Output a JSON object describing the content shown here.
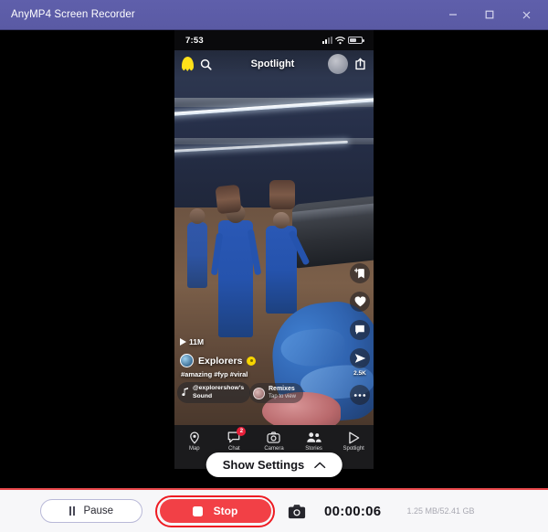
{
  "window": {
    "title": "AnyMP4 Screen Recorder",
    "controls": {
      "minimize": "minimize-icon",
      "maximize": "maximize-icon",
      "close": "close-icon"
    },
    "titlebar_color": "#5c5ca8"
  },
  "phone": {
    "status_bar": {
      "time": "7:53",
      "signal_icon": "cellular-signal-icon",
      "wifi_icon": "wifi-icon",
      "battery_icon": "battery-icon"
    },
    "header": {
      "profile_icon": "bitmoji-ghost-icon",
      "search_icon": "search-icon",
      "title": "Spotlight",
      "avatar": "avatar",
      "share_icon": "share-export-icon"
    },
    "video": {
      "view_count": "11M",
      "play_icon": "play-icon",
      "creator": "Explorers",
      "verified_badge": "verified-badge-icon",
      "hashtags": "#amazing #fyp #viral",
      "sound": {
        "note_icon": "music-note-icon",
        "line1": "@explorershow's",
        "line2": "Sound"
      },
      "remixes": {
        "title": "Remixes",
        "subtitle": "Tap to view"
      },
      "actions": [
        {
          "name": "bookmark-add",
          "icon": "bookmark-plus-icon",
          "count": ""
        },
        {
          "name": "like",
          "icon": "heart-icon",
          "count": ""
        },
        {
          "name": "comment",
          "icon": "comment-icon",
          "count": ""
        },
        {
          "name": "share",
          "icon": "share-arrow-icon",
          "count": "2.5K"
        },
        {
          "name": "more",
          "icon": "more-dots-icon",
          "count": ""
        }
      ]
    },
    "nav": [
      {
        "label": "Map",
        "icon": "map-pin-icon",
        "badge": ""
      },
      {
        "label": "Chat",
        "icon": "chat-bubble-icon",
        "badge": "2"
      },
      {
        "label": "Camera",
        "icon": "camera-icon",
        "badge": ""
      },
      {
        "label": "Stories",
        "icon": "people-icon",
        "badge": ""
      },
      {
        "label": "Spotlight",
        "icon": "play-triangle-icon",
        "badge": ""
      }
    ]
  },
  "show_settings": {
    "label": "Show Settings",
    "chevron": "chevron-up-icon"
  },
  "toolbar": {
    "pause_label": "Pause",
    "pause_icon": "pause-icon",
    "stop_label": "Stop",
    "stop_icon": "stop-square-icon",
    "screenshot_icon": "camera-icon",
    "timer": "00:00:06",
    "storage": "1.25 MB/52.41 GB",
    "accent_red": "#f24046",
    "highlight_red": "#ee1b22"
  }
}
